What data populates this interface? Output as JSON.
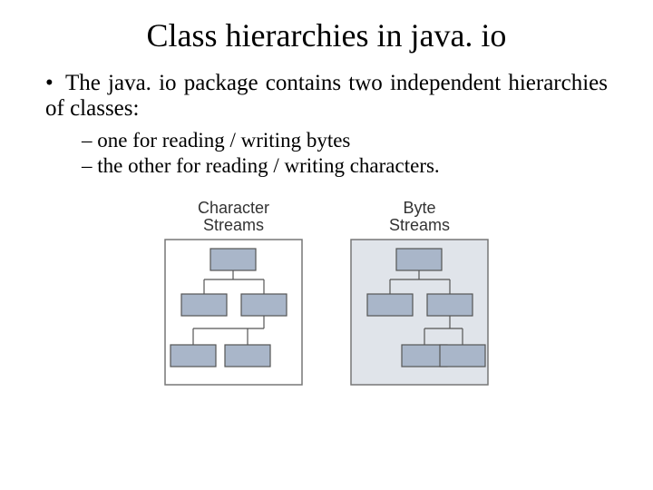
{
  "title": "Class hierarchies in java. io",
  "bullet_main": "The java. io package contains two independent hierarchies of classes:",
  "sub_bullet_1": "one for reading / writing bytes",
  "sub_bullet_2": "the other for reading / writing characters.",
  "diagram": {
    "left_label_line1": "Character",
    "left_label_line2": "Streams",
    "right_label_line1": "Byte",
    "right_label_line2": "Streams"
  }
}
